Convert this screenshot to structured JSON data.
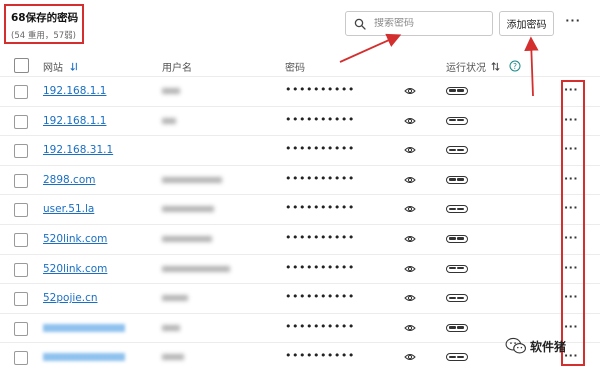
{
  "header": {
    "title": "68保存的密码",
    "subtitle": "(54 重用，57弱)",
    "search_placeholder": "搜索密码",
    "add_button": "添加密码",
    "more": "···"
  },
  "columns": {
    "site": "网站",
    "site_sort_icon": "sort-icon",
    "username": "用户名",
    "password": "密码",
    "status": "运行状况",
    "status_sort_icon": "sort-arrows-icon",
    "help_icon": "help-icon"
  },
  "rows": [
    {
      "site": "192.168.1.1",
      "password": "••••••••••",
      "more": "···"
    },
    {
      "site": "192.168.1.1",
      "password": "••••••••••",
      "more": "···"
    },
    {
      "site": "192.168.31.1",
      "password": "••••••••••",
      "more": "···"
    },
    {
      "site": "2898.com",
      "password": "••••••••••",
      "more": "···"
    },
    {
      "site": "user.51.la",
      "password": "••••••••••",
      "more": "···"
    },
    {
      "site": "520link.com",
      "password": "••••••••••",
      "more": "···"
    },
    {
      "site": "520link.com",
      "password": "••••••••••",
      "more": "···"
    },
    {
      "site": "52pojie.cn",
      "password": "••••••••••",
      "more": "···"
    },
    {
      "site": "",
      "password": "••••••••••",
      "more": "···"
    },
    {
      "site": "",
      "password": "••••••••••",
      "more": "···"
    }
  ],
  "watermark": {
    "text": "软件猪",
    "icon": "wechat-icon"
  },
  "colors": {
    "accent_link": "#1a6fc4",
    "annotation_red": "#d32f2f",
    "help_blue": "#1a8a8a"
  }
}
